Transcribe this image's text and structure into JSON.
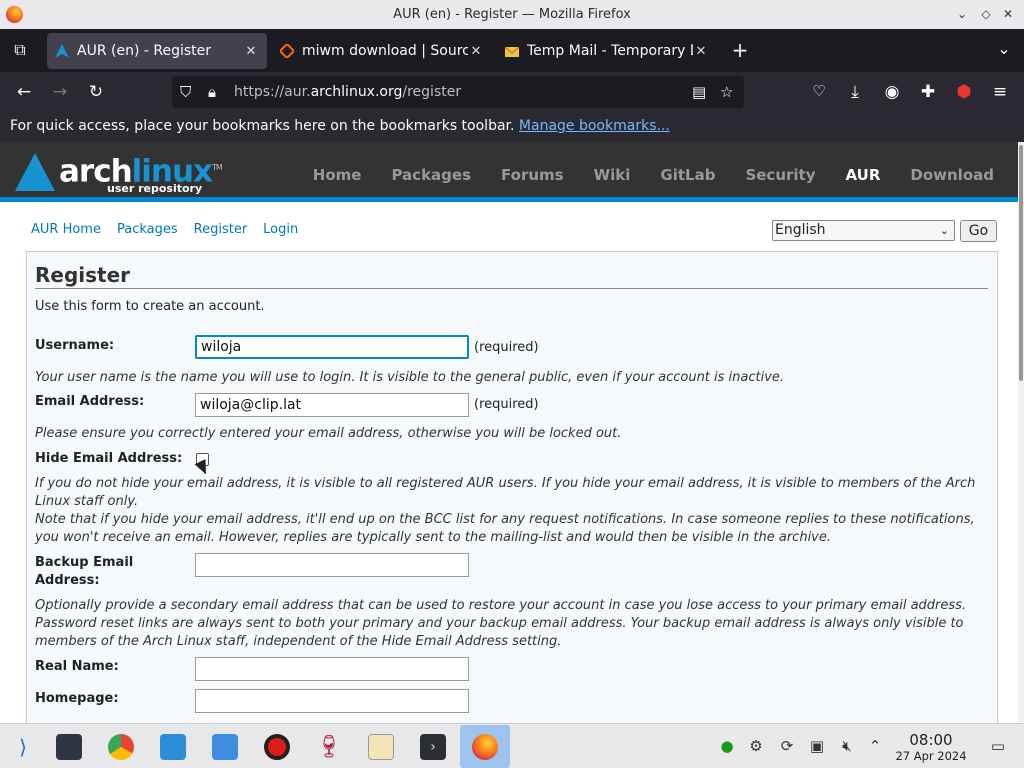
{
  "window": {
    "title": "AUR (en) - Register — Mozilla Firefox"
  },
  "tabs": [
    {
      "label": "AUR (en) - Register",
      "active": true
    },
    {
      "label": "miwm download | SourceForge",
      "active": false
    },
    {
      "label": "Temp Mail - Temporary Disposable Email",
      "active": false
    }
  ],
  "urlbar": {
    "prefix": "https://aur.",
    "domain": "archlinux.org",
    "path": "/register"
  },
  "bookmarks": {
    "text": "For quick access, place your bookmarks here on the bookmarks toolbar.",
    "link": "Manage bookmarks..."
  },
  "arch": {
    "logo_main": "arch",
    "logo_accent": "linux",
    "logo_sub": "user repository",
    "logo_tm": "TM",
    "nav": [
      "Home",
      "Packages",
      "Forums",
      "Wiki",
      "GitLab",
      "Security",
      "AUR",
      "Download"
    ],
    "nav_active": "AUR"
  },
  "subnav": [
    "AUR Home",
    "Packages",
    "Register",
    "Login"
  ],
  "language": {
    "selected": "English",
    "go": "Go"
  },
  "form": {
    "title": "Register",
    "intro": "Use this form to create an account.",
    "username_label": "Username:",
    "username_value": "wiloja",
    "required": "(required)",
    "username_help": "Your user name is the name you will use to login. It is visible to the general public, even if your account is inactive.",
    "email_label": "Email Address:",
    "email_value": "wiloja@clip.lat",
    "email_help": "Please ensure you correctly entered your email address, otherwise you will be locked out.",
    "hide_label": "Hide Email Address:",
    "hide_help1a": "If you do not hide your email address, it is visible to all registered AUR users. If you hide your email address, it is visible to members of the Arch",
    "hide_help1b": "Linux staff only.",
    "hide_help2a": "Note that if you hide your email address, it'll end up on the BCC list for any request notifications. In case someone replies to these notifications,",
    "hide_help2b": "you won't receive an email. However, replies are typically sent to the mailing-list and would then be visible in the archive.",
    "backup_label_1": "Backup Email",
    "backup_label_2": "Address:",
    "backup_help1": "Optionally provide a secondary email address that can be used to restore your account in case you lose access to your primary email address.",
    "backup_help2": "Password reset links are always sent to both your primary and your backup email address. Your backup email address is always only visible to",
    "backup_help3": "members of the Arch Linux staff, independent of the Hide Email Address setting.",
    "realname_label": "Real Name:",
    "homepage_label": "Homepage:"
  },
  "taskbar": {
    "time": "08:00",
    "date": "27 Apr 2024"
  },
  "colors": {
    "arch_blue": "#1793d1",
    "link": "#0077bb",
    "header_bg": "#333333",
    "accent_border": "#0088cc"
  }
}
